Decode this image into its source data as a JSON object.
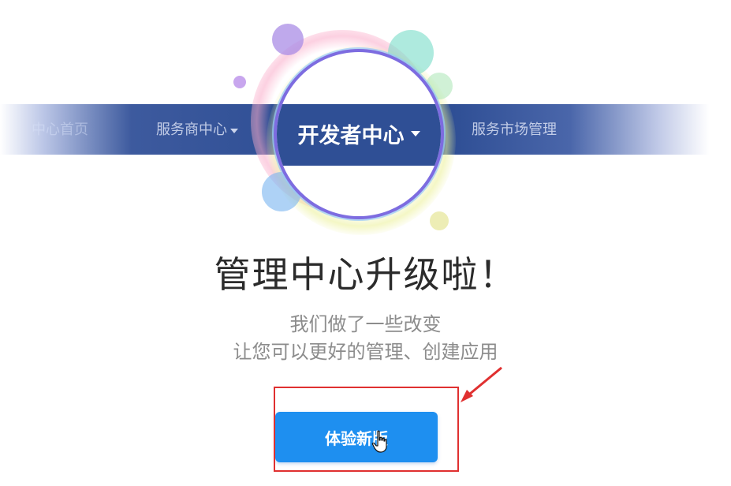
{
  "nav": {
    "items": [
      {
        "label": "中心首页",
        "has_dropdown": false
      },
      {
        "label": "服务商中心",
        "has_dropdown": true
      },
      {
        "label": "开发者中心",
        "has_dropdown": true,
        "active": true
      },
      {
        "label": "服务市场管理",
        "has_dropdown": false
      }
    ]
  },
  "main": {
    "headline": "管理中心升级啦！",
    "subtitle_line1": "我们做了一些改变",
    "subtitle_line2": "让您可以更好的管理、创建应用",
    "cta_label": "体验新版"
  },
  "colors": {
    "nav_band": "#2f4f95",
    "cta": "#1e8ff0",
    "highlight": "#e03030",
    "circle_border": "#7d6ce0"
  },
  "icons": [
    "caret-down-icon",
    "hand-pointer-icon",
    "red-arrow-icon"
  ]
}
